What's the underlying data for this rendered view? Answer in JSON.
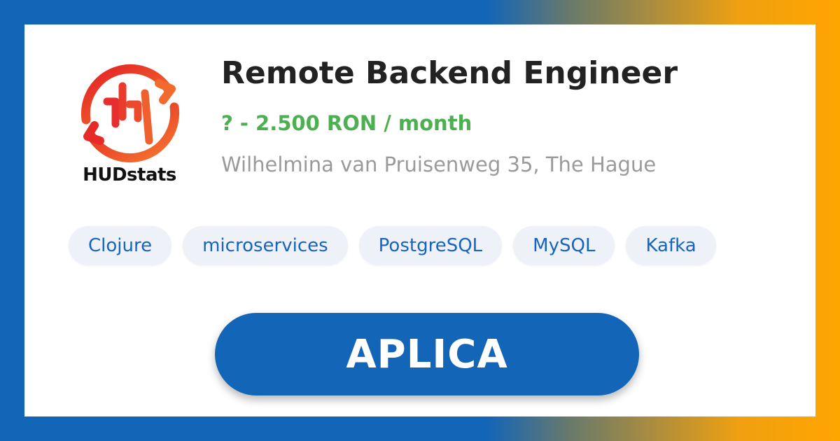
{
  "company": {
    "name": "HUDstats",
    "logo_icon": "hudstats-logo-icon",
    "brand_color": "#e62e2e"
  },
  "job": {
    "title": "Remote Backend Engineer",
    "salary": "? - 2.500 RON / month",
    "address": "Wilhelmina van Pruisenweg 35, The Hague"
  },
  "tags": [
    "Clojure",
    "microservices",
    "PostgreSQL",
    "MySQL",
    "Kafka"
  ],
  "apply": {
    "label": "APLICA"
  },
  "colors": {
    "accent": "#1365b8",
    "salary": "#4caf50",
    "tag_text": "#1565c0",
    "tag_bg": "#eef1f8",
    "frame_gradient_end": "#ffa500"
  }
}
